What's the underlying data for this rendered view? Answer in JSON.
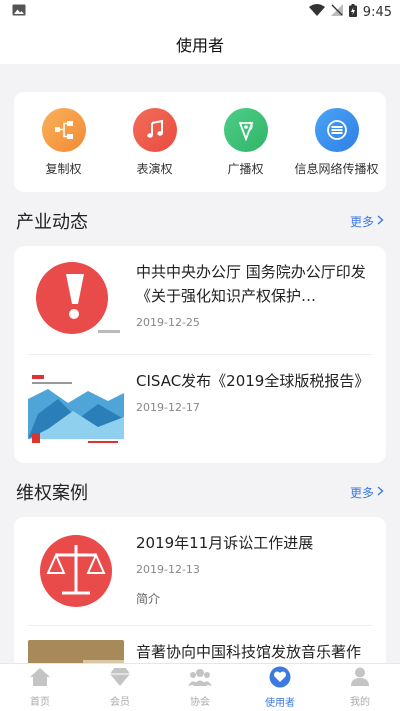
{
  "status_bar": {
    "time": "9:45"
  },
  "header": {
    "title": "使用者"
  },
  "categories": [
    {
      "label": "复制权",
      "icon": "copy-flow-icon",
      "color": "#f7a04a"
    },
    {
      "label": "表演权",
      "icon": "music-note-icon",
      "color": "#ef5b4c"
    },
    {
      "label": "广播权",
      "icon": "broadcast-icon",
      "color": "#3cc077"
    },
    {
      "label": "信息网络传播权",
      "icon": "network-icon",
      "color": "#3b8ef0"
    }
  ],
  "industry_news": {
    "title": "产业动态",
    "more": "更多",
    "items": [
      {
        "title": "中共中央办公厅 国务院办公厅印发《关于强化知识产权保护…",
        "date": "2019-12-25"
      },
      {
        "title": "CISAC发布《2019全球版税报告》",
        "date": "2019-12-17"
      }
    ]
  },
  "rights_cases": {
    "title": "维权案例",
    "more": "更多",
    "items": [
      {
        "title": "2019年11月诉讼工作进展",
        "date": "2019-12-13",
        "brief": "简介"
      },
      {
        "title": "音著协向中国科技馆发放音乐著作权许可",
        "date": ""
      }
    ]
  },
  "tabs": [
    {
      "label": "首页",
      "icon": "home-icon",
      "active": false
    },
    {
      "label": "会员",
      "icon": "member-icon",
      "active": false
    },
    {
      "label": "协会",
      "icon": "association-icon",
      "active": false
    },
    {
      "label": "使用者",
      "icon": "user-heart-icon",
      "active": true
    },
    {
      "label": "我的",
      "icon": "profile-icon",
      "active": false
    }
  ],
  "colors": {
    "accent": "#3d7ae0",
    "background": "#f3f3f5"
  }
}
